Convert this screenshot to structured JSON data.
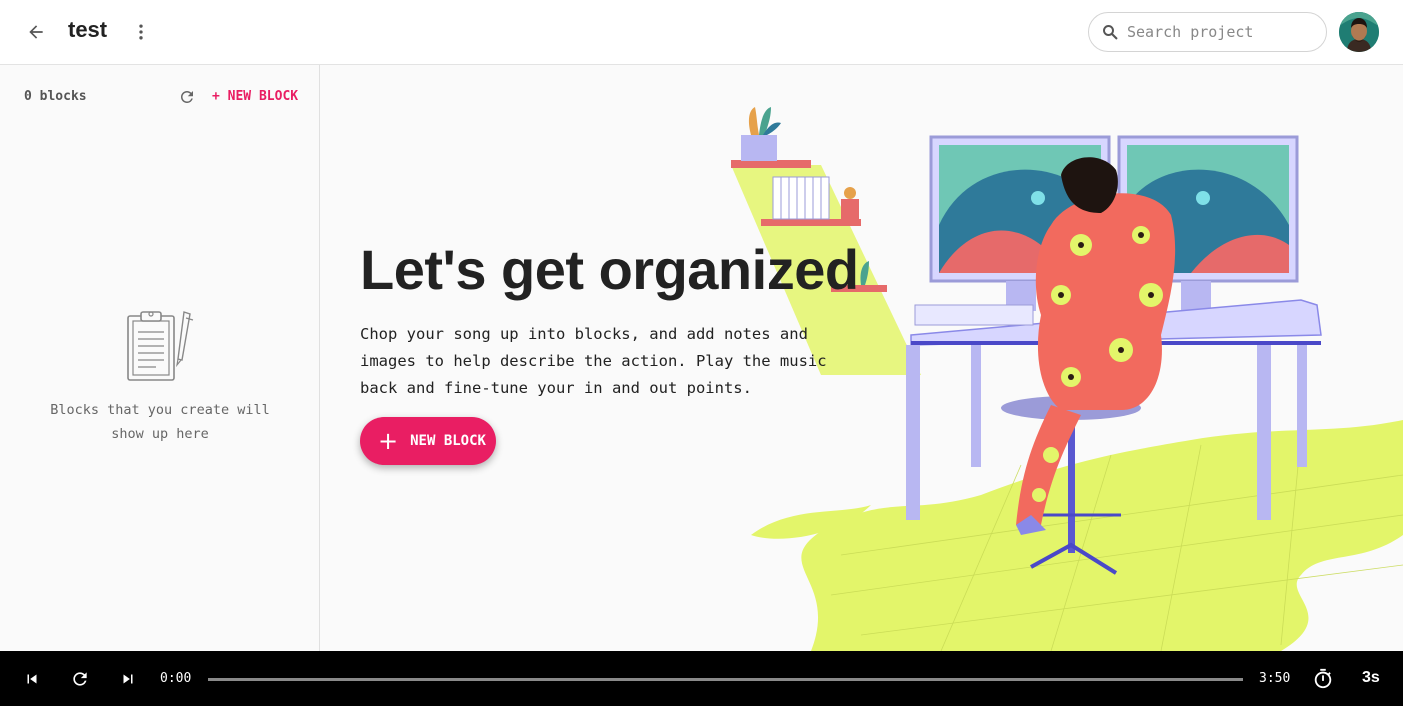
{
  "header": {
    "title": "test",
    "search_placeholder": "Search project",
    "back_icon": "arrow-left-icon",
    "more_icon": "vertical-dots-icon"
  },
  "sidebar": {
    "count_label": "0 blocks",
    "new_block_label": "+ NEW BLOCK",
    "empty_text": "Blocks that you create will show up here"
  },
  "main": {
    "headline": "Let's get organized",
    "description": "Chop your song up into blocks, and add notes and images to help describe the action. Play the music back and fine-tune your in and out points.",
    "cta_label": "NEW BLOCK"
  },
  "player": {
    "current_time": "0:00",
    "total_time": "3:50",
    "speed_label": "3s",
    "progress": 0
  },
  "colors": {
    "accent": "#e91e63",
    "player_bg": "#000000",
    "lime": "#e3f56a"
  }
}
